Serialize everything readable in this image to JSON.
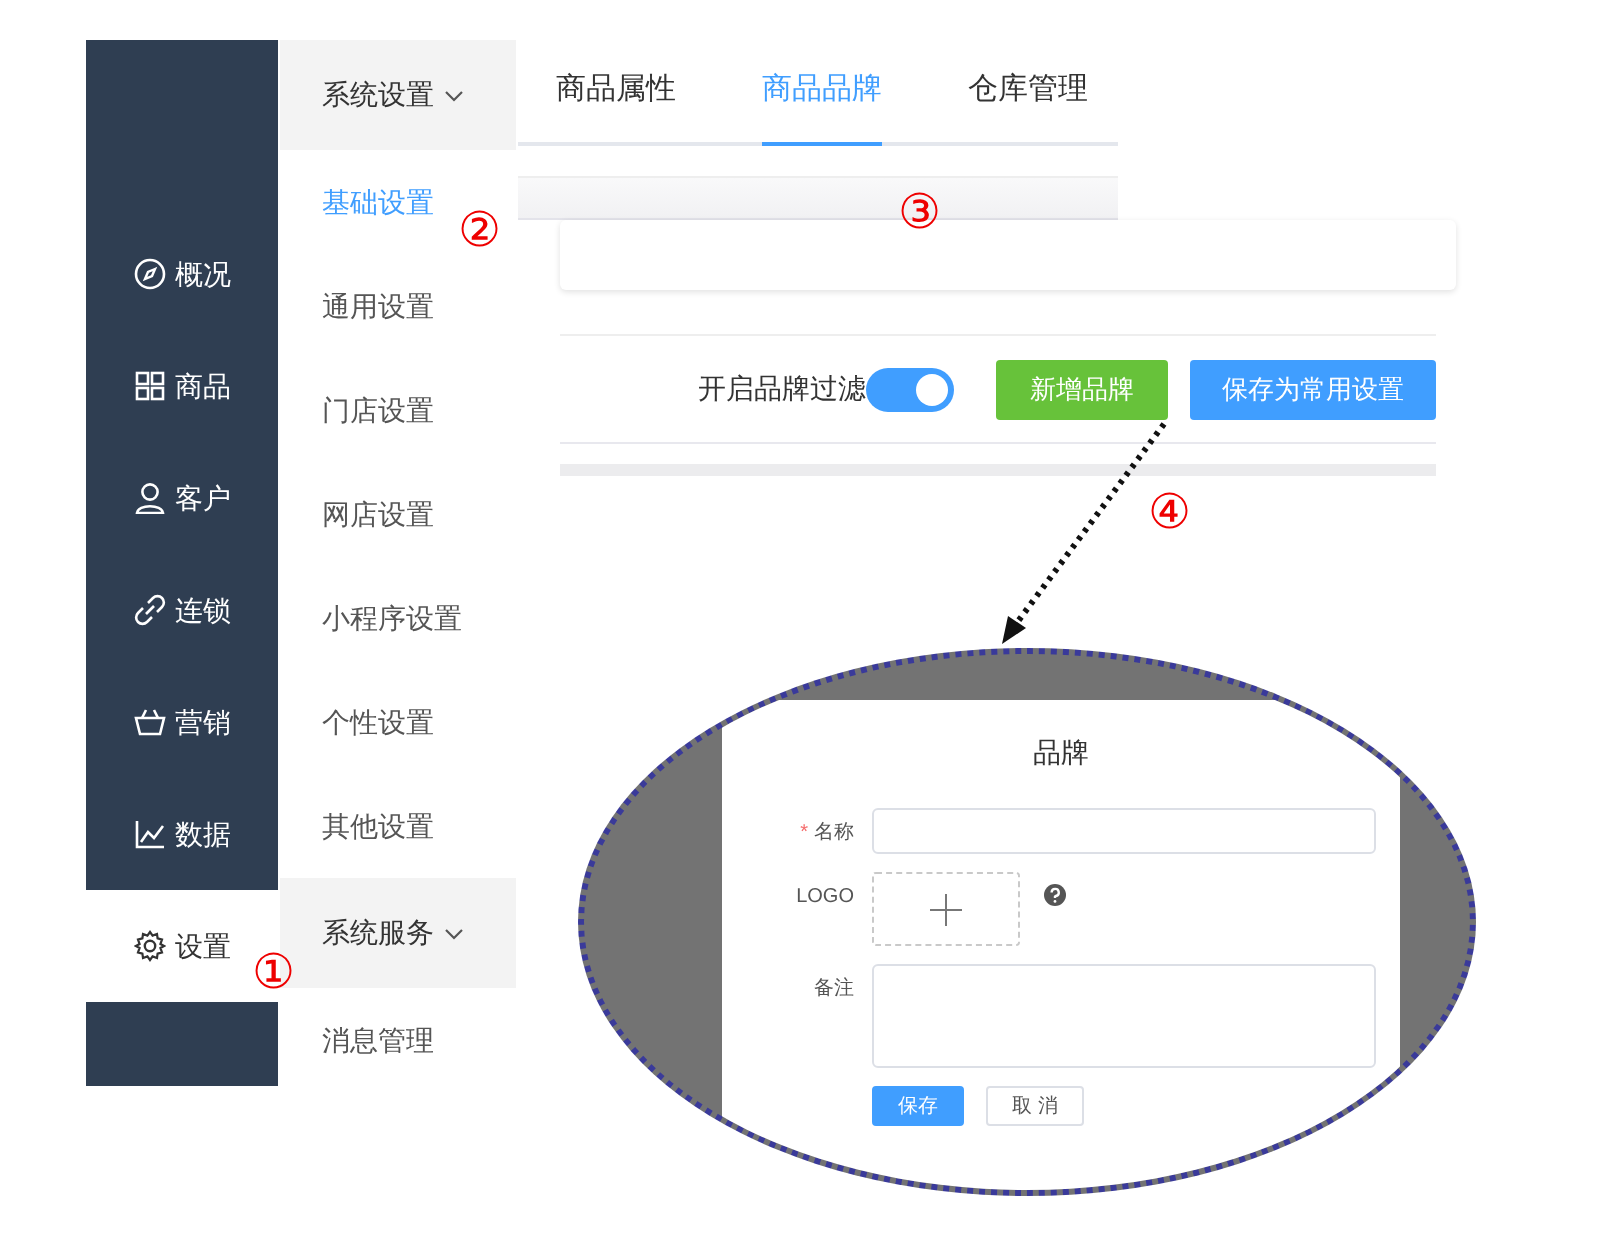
{
  "sidebar": {
    "items": [
      {
        "label": "概况",
        "selected": false
      },
      {
        "label": "商品",
        "selected": false
      },
      {
        "label": "客户",
        "selected": false
      },
      {
        "label": "连锁",
        "selected": false
      },
      {
        "label": "营销",
        "selected": false
      },
      {
        "label": "数据",
        "selected": false
      },
      {
        "label": "设置",
        "selected": true
      }
    ]
  },
  "submenu": {
    "groups": [
      {
        "title": "系统设置",
        "expanded": true,
        "items": [
          {
            "label": "基础设置",
            "selected": true
          },
          {
            "label": "通用设置",
            "selected": false
          },
          {
            "label": "门店设置",
            "selected": false
          },
          {
            "label": "网店设置",
            "selected": false
          },
          {
            "label": "小程序设置",
            "selected": false
          },
          {
            "label": "个性设置",
            "selected": false
          },
          {
            "label": "其他设置",
            "selected": false
          }
        ]
      },
      {
        "title": "系统服务",
        "expanded": true,
        "items": [
          {
            "label": "消息管理",
            "selected": false
          }
        ]
      }
    ]
  },
  "tabs": [
    {
      "label": "商品属性",
      "selected": false
    },
    {
      "label": "商品品牌",
      "selected": true
    },
    {
      "label": "仓库管理",
      "selected": false
    }
  ],
  "toolbar": {
    "filter_label": "开启品牌过滤",
    "filter_on": true,
    "buttons": [
      {
        "label": "新增品牌",
        "kind": "success"
      },
      {
        "label": "保存为常用设置",
        "kind": "primary"
      }
    ]
  },
  "annotations": [
    {
      "label": "①"
    },
    {
      "label": "②"
    },
    {
      "label": "③"
    },
    {
      "label": "④"
    }
  ],
  "dialog": {
    "title": "品牌",
    "fields": [
      {
        "label": "名称",
        "required_mark": "*",
        "kind": "input"
      },
      {
        "label": "LOGO",
        "kind": "upload"
      },
      {
        "label": "备注",
        "kind": "textarea"
      }
    ],
    "buttons": [
      {
        "label": "保存",
        "kind": "primary"
      },
      {
        "label": "取 消",
        "kind": "default"
      }
    ]
  }
}
